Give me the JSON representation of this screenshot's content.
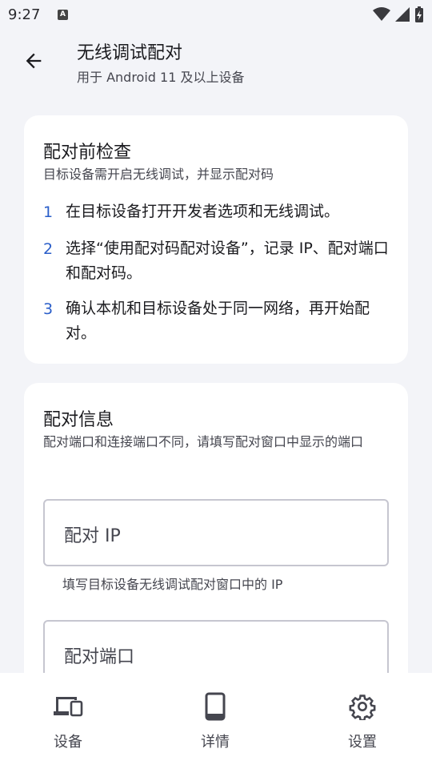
{
  "status_bar": {
    "time": "9:27",
    "notification_letter": "A"
  },
  "app_bar": {
    "title": "无线调试配对",
    "subtitle": "用于 Android 11 及以上设备"
  },
  "precheck": {
    "title": "配对前检查",
    "description": "目标设备需开启无线调试，并显示配对码",
    "steps": [
      {
        "num": "1",
        "text": "在目标设备打开开发者选项和无线调试。"
      },
      {
        "num": "2",
        "text": "选择“使用配对码配对设备”，记录 IP、配对端口和配对码。"
      },
      {
        "num": "3",
        "text": "确认本机和目标设备处于同一网络，再开始配对。"
      }
    ]
  },
  "pair_info": {
    "title": "配对信息",
    "description": "配对端口和连接端口不同，请填写配对窗口中显示的端口",
    "ip_field": {
      "label": "配对 IP",
      "help": "填写目标设备无线调试配对窗口中的 IP"
    },
    "port_field": {
      "label": "配对端口"
    }
  },
  "bottom_nav": [
    {
      "label": "设备",
      "icon": "devices-icon"
    },
    {
      "label": "详情",
      "icon": "phone-icon"
    },
    {
      "label": "设置",
      "icon": "gear-icon"
    }
  ],
  "colors": {
    "accent": "#2a5ec9",
    "background": "#f3f4f8",
    "card": "#ffffff"
  }
}
